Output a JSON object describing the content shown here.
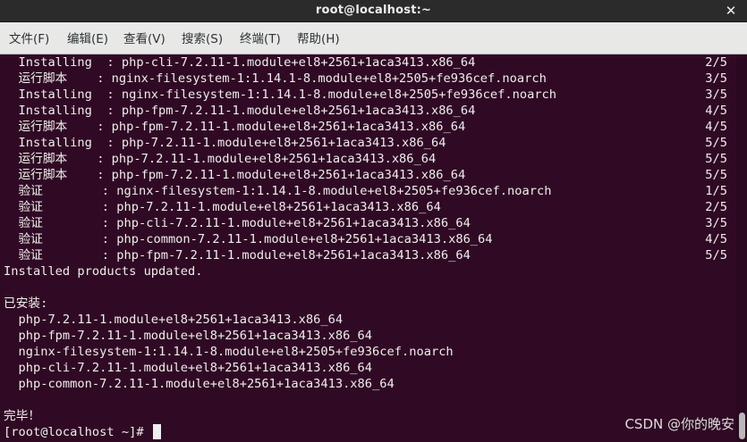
{
  "window": {
    "title": "root@localhost:~",
    "close_glyph": "✕"
  },
  "menu": {
    "items": [
      {
        "label": "文件(F)"
      },
      {
        "label": "编辑(E)"
      },
      {
        "label": "查看(V)"
      },
      {
        "label": "搜索(S)"
      },
      {
        "label": "终端(T)"
      },
      {
        "label": "帮助(H)"
      }
    ]
  },
  "terminal": {
    "lines": [
      {
        "text": "  Installing  : php-cli-7.2.11-1.module+el8+2561+1aca3413.x86_64",
        "progress": "2/5"
      },
      {
        "text": "  运行脚本    : nginx-filesystem-1:1.14.1-8.module+el8+2505+fe936cef.noarch",
        "progress": "3/5"
      },
      {
        "text": "  Installing  : nginx-filesystem-1:1.14.1-8.module+el8+2505+fe936cef.noarch",
        "progress": "3/5"
      },
      {
        "text": "  Installing  : php-fpm-7.2.11-1.module+el8+2561+1aca3413.x86_64",
        "progress": "4/5"
      },
      {
        "text": "  运行脚本    : php-fpm-7.2.11-1.module+el8+2561+1aca3413.x86_64",
        "progress": "4/5"
      },
      {
        "text": "  Installing  : php-7.2.11-1.module+el8+2561+1aca3413.x86_64",
        "progress": "5/5"
      },
      {
        "text": "  运行脚本    : php-7.2.11-1.module+el8+2561+1aca3413.x86_64",
        "progress": "5/5"
      },
      {
        "text": "  运行脚本    : php-fpm-7.2.11-1.module+el8+2561+1aca3413.x86_64",
        "progress": "5/5"
      },
      {
        "text": "  验证        : nginx-filesystem-1:1.14.1-8.module+el8+2505+fe936cef.noarch",
        "progress": "1/5"
      },
      {
        "text": "  验证        : php-7.2.11-1.module+el8+2561+1aca3413.x86_64",
        "progress": "2/5"
      },
      {
        "text": "  验证        : php-cli-7.2.11-1.module+el8+2561+1aca3413.x86_64",
        "progress": "3/5"
      },
      {
        "text": "  验证        : php-common-7.2.11-1.module+el8+2561+1aca3413.x86_64",
        "progress": "4/5"
      },
      {
        "text": "  验证        : php-fpm-7.2.11-1.module+el8+2561+1aca3413.x86_64",
        "progress": "5/5"
      },
      {
        "text": "Installed products updated.",
        "progress": ""
      },
      {
        "text": "",
        "progress": ""
      },
      {
        "text": "已安装:",
        "progress": ""
      },
      {
        "text": "  php-7.2.11-1.module+el8+2561+1aca3413.x86_64",
        "progress": ""
      },
      {
        "text": "  php-fpm-7.2.11-1.module+el8+2561+1aca3413.x86_64",
        "progress": ""
      },
      {
        "text": "  nginx-filesystem-1:1.14.1-8.module+el8+2505+fe936cef.noarch",
        "progress": ""
      },
      {
        "text": "  php-cli-7.2.11-1.module+el8+2561+1aca3413.x86_64",
        "progress": ""
      },
      {
        "text": "  php-common-7.2.11-1.module+el8+2561+1aca3413.x86_64",
        "progress": ""
      },
      {
        "text": "",
        "progress": ""
      },
      {
        "text": "完毕！",
        "progress": ""
      }
    ],
    "prompt": "[root@localhost ~]# "
  },
  "scrollbar": {
    "position_fraction": 1.0
  },
  "watermark": "CSDN @你的晚安",
  "colors": {
    "terminal_background": "#300a24",
    "terminal_foreground": "#eeeeec",
    "titlebar_background": "#2b2b2b",
    "menubar_background": "#e8e8e7"
  }
}
